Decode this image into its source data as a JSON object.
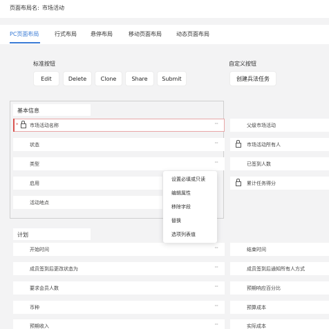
{
  "header": {
    "label": "页面布局名:",
    "value": "市场活动"
  },
  "tabs": [
    "PC页面布局",
    "行式布局",
    "悬停布局",
    "移动页面布局",
    "动态页面布局"
  ],
  "standard_buttons": {
    "title": "标准按钮",
    "items": [
      "Edit",
      "Delete",
      "Clone",
      "Share",
      "Submit"
    ]
  },
  "custom_buttons": {
    "title": "自定义按钮",
    "items": [
      "创建兵法任务"
    ]
  },
  "basic_info": {
    "title": "基本信息",
    "left": [
      "市场活动名称",
      "状态",
      "类型",
      "启用",
      "活动地点"
    ],
    "right": [
      "父级市场活动",
      "市场活动所有人",
      "已签到人数",
      "累计任务得分"
    ]
  },
  "context_menu": [
    "设置必填或只读",
    "编辑属性",
    "移除字段",
    "替换",
    "选项列表值"
  ],
  "plan": {
    "title": "计划",
    "left": [
      "开始时间",
      "成员签到后更改状态为",
      "要求会员人数",
      "币种",
      "预期收入"
    ],
    "right": [
      "结束时间",
      "成员签到后通知所有人方式",
      "预期响应百分比",
      "预算成本",
      "实际成本"
    ]
  },
  "icons": {
    "more": "more-dots-icon",
    "lock": "lock-icon"
  },
  "colors": {
    "accent": "#3a7bd5",
    "required": "#d9534f"
  }
}
